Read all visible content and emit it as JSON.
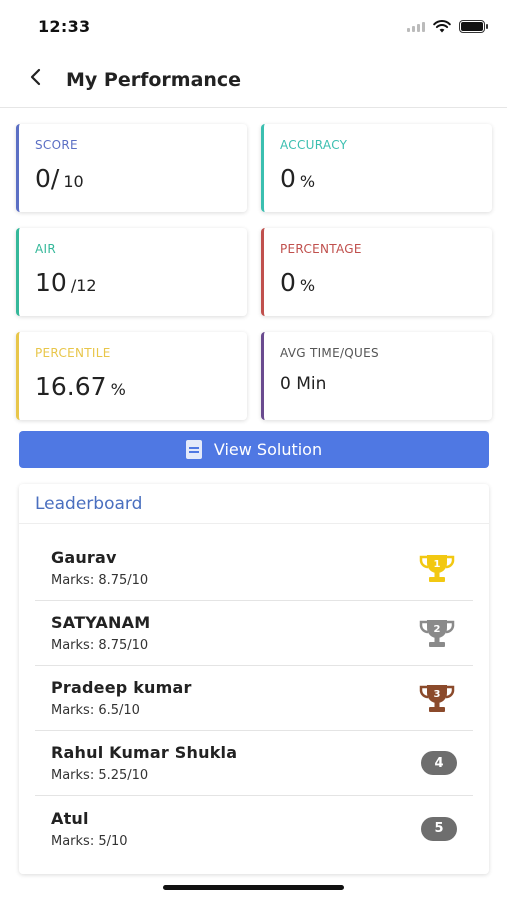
{
  "status_bar": {
    "time": "12:33"
  },
  "header": {
    "title": "My Performance"
  },
  "stats": {
    "score": {
      "label": "SCORE",
      "value": "0/",
      "unit": "10",
      "color": "#5b6fc4"
    },
    "accuracy": {
      "label": "ACCURACY",
      "value": "0",
      "unit": "%",
      "color": "#3bbfb0"
    },
    "air": {
      "label": "AIR",
      "value": "10",
      "unit": "/12",
      "color": "#35b89a"
    },
    "percentage": {
      "label": "PERCENTAGE",
      "value": "0",
      "unit": "%",
      "color": "#c0504d"
    },
    "percentile": {
      "label": "PERCENTILE",
      "value": "16.67",
      "unit": "%",
      "color": "#e8c64a"
    },
    "avg_time": {
      "label": "AVG TIME/QUES",
      "value": "0 Min",
      "color": "#6a4b8f"
    }
  },
  "view_solution": {
    "label": "View Solution"
  },
  "leaderboard": {
    "title": "Leaderboard",
    "entries": [
      {
        "name": "Gaurav",
        "marks": "Marks: 8.75/10",
        "rank": "1",
        "trophy_color": "#f2c811"
      },
      {
        "name": "SATYANAM",
        "marks": "Marks: 8.75/10",
        "rank": "2",
        "trophy_color": "#8a8a8a"
      },
      {
        "name": "Pradeep kumar",
        "marks": "Marks: 6.5/10",
        "rank": "3",
        "trophy_color": "#8b4a2b"
      },
      {
        "name": "Rahul Kumar Shukla",
        "marks": "Marks: 5.25/10",
        "rank": "4"
      },
      {
        "name": "Atul",
        "marks": "Marks: 5/10",
        "rank": "5"
      }
    ]
  }
}
